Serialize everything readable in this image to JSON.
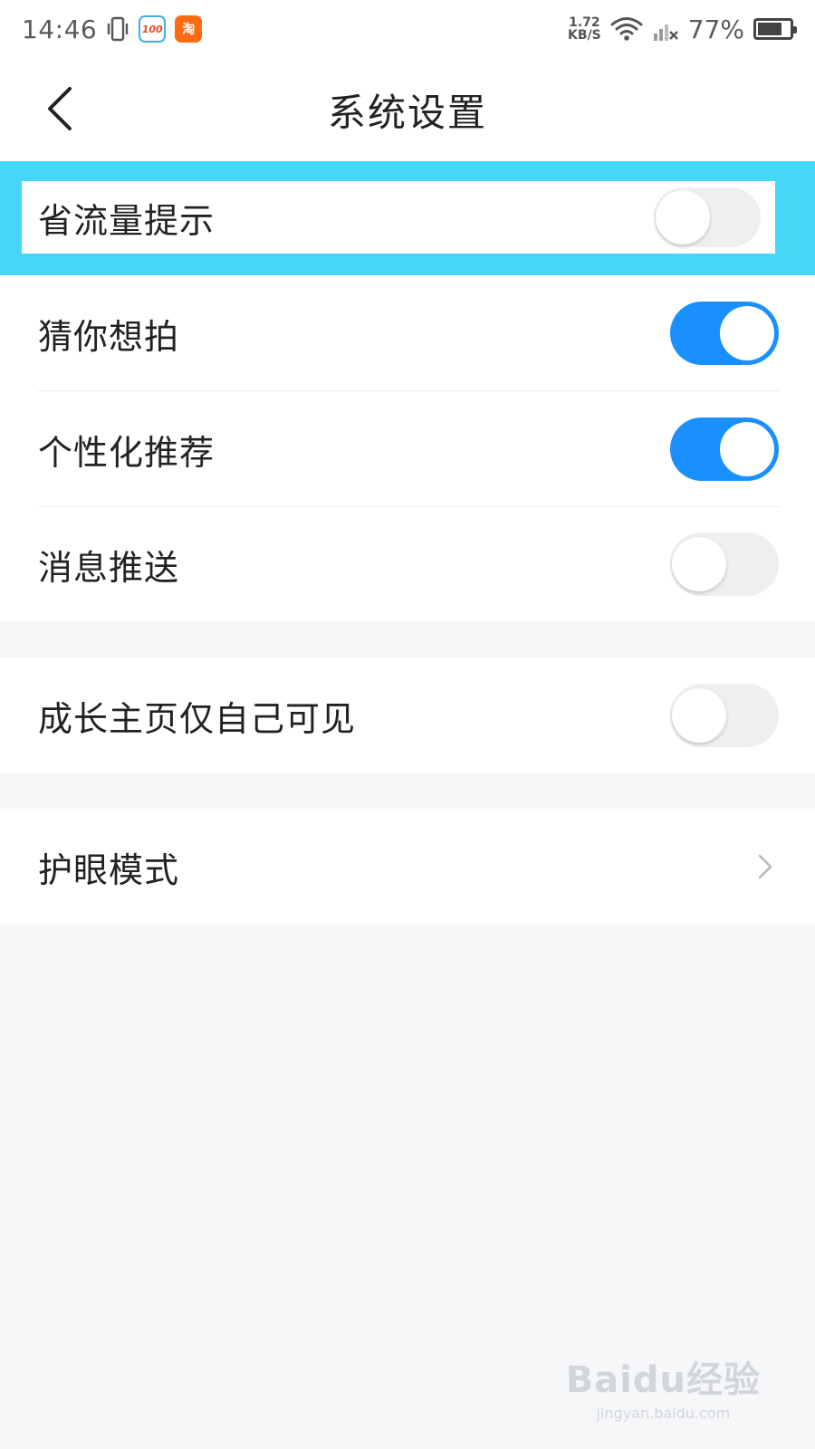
{
  "status_bar": {
    "time": "14:46",
    "vibrate_icon": "vibrate-icon",
    "app_icon_1_text": "100",
    "app_icon_2_text": "淘",
    "net_speed_value": "1.72",
    "net_speed_unit": "KB/S",
    "battery_percent": "77%",
    "battery_level": 0.77
  },
  "nav": {
    "title": "系统设置",
    "back_icon": "chevron-left-icon"
  },
  "colors": {
    "highlight": "#46d6f8",
    "toggle_on": "#1a90ff",
    "toggle_off": "#eeeff1",
    "background": "#f6f7f9"
  },
  "settings": {
    "group1": [
      {
        "label": "省流量提示",
        "enabled": false
      },
      {
        "label": "猜你想拍",
        "enabled": true
      },
      {
        "label": "个性化推荐",
        "enabled": true
      },
      {
        "label": "消息推送",
        "enabled": false
      }
    ],
    "group2": [
      {
        "label": "成长主页仅自己可见",
        "enabled": false
      }
    ],
    "group3": [
      {
        "label": "护眼模式",
        "icon": "chevron-right-icon"
      }
    ]
  },
  "watermark": {
    "brand": "Baidu经验",
    "url": "jingyan.baidu.com"
  }
}
